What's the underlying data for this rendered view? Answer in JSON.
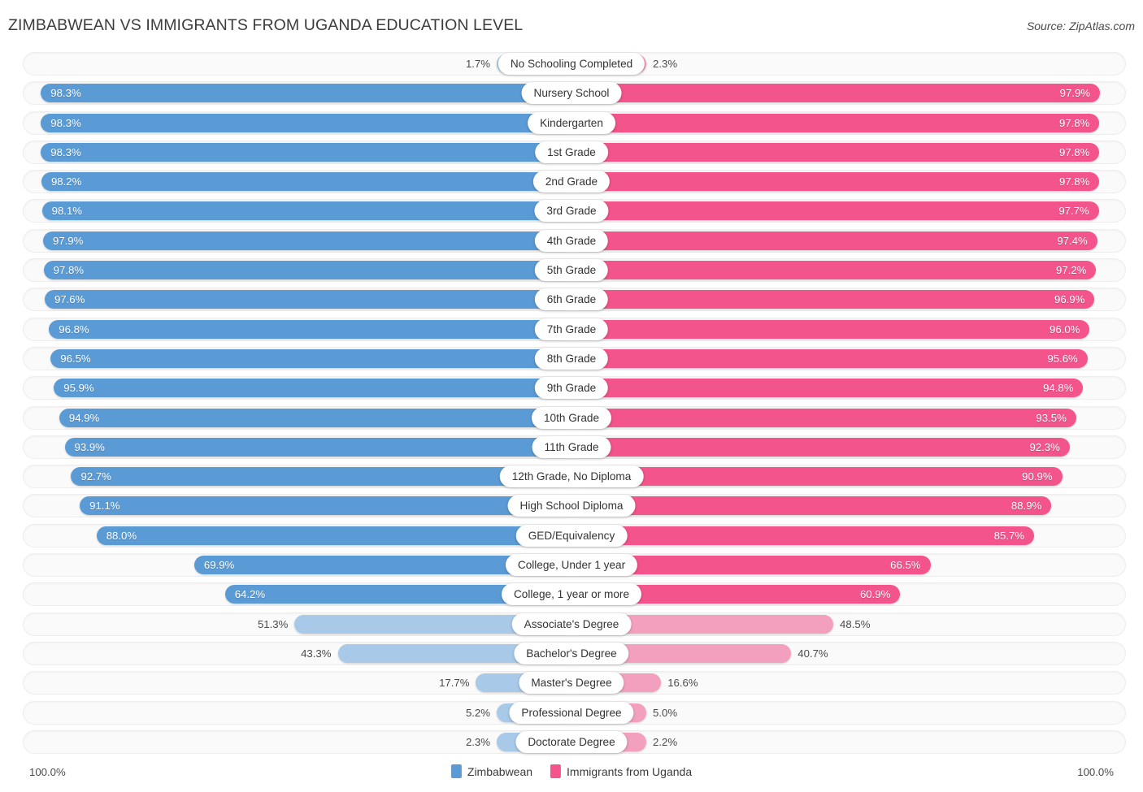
{
  "header": {
    "title": "ZIMBABWEAN VS IMMIGRANTS FROM UGANDA EDUCATION LEVEL",
    "source": "Source: ZipAtlas.com"
  },
  "legend": {
    "items": [
      {
        "label": "Zimbabwean",
        "color": "#5B9BD5"
      },
      {
        "label": "Immigrants from Uganda",
        "color": "#F2548B"
      }
    ]
  },
  "axis": {
    "left": "100.0%",
    "right": "100.0%"
  },
  "colors": {
    "blue_strong": "#5B9BD5",
    "blue_light": "#A8C9E8",
    "pink_strong": "#F2548B",
    "pink_light": "#F3A0BE",
    "track": "#fafafa"
  },
  "chart_data": {
    "type": "bar",
    "title": "ZIMBABWEAN VS IMMIGRANTS FROM UGANDA EDUCATION LEVEL",
    "orientation": "horizontal-diverging",
    "xlabel": "",
    "ylabel": "",
    "xlim": [
      0,
      100
    ],
    "grid": false,
    "legend_position": "bottom-center",
    "categories": [
      "No Schooling Completed",
      "Nursery School",
      "Kindergarten",
      "1st Grade",
      "2nd Grade",
      "3rd Grade",
      "4th Grade",
      "5th Grade",
      "6th Grade",
      "7th Grade",
      "8th Grade",
      "9th Grade",
      "10th Grade",
      "11th Grade",
      "12th Grade, No Diploma",
      "High School Diploma",
      "GED/Equivalency",
      "College, Under 1 year",
      "College, 1 year or more",
      "Associate's Degree",
      "Bachelor's Degree",
      "Master's Degree",
      "Professional Degree",
      "Doctorate Degree"
    ],
    "series": [
      {
        "name": "Zimbabwean",
        "color": "#5B9BD5",
        "values": [
          1.7,
          98.3,
          98.3,
          98.3,
          98.2,
          98.1,
          97.9,
          97.8,
          97.6,
          96.8,
          96.5,
          95.9,
          94.9,
          93.9,
          92.7,
          91.1,
          88.0,
          69.9,
          64.2,
          51.3,
          43.3,
          17.7,
          5.2,
          2.3
        ]
      },
      {
        "name": "Immigrants from Uganda",
        "color": "#F2548B",
        "values": [
          2.3,
          97.9,
          97.8,
          97.8,
          97.8,
          97.7,
          97.4,
          97.2,
          96.9,
          96.0,
          95.6,
          94.8,
          93.5,
          92.3,
          90.9,
          88.9,
          85.7,
          66.5,
          60.9,
          48.5,
          40.7,
          16.6,
          5.0,
          2.2
        ]
      }
    ]
  },
  "rows": [
    {
      "label": "No Schooling Completed",
      "left": "1.7%",
      "right": "2.3%",
      "lv": 1.7,
      "rv": 2.3,
      "tone": "light"
    },
    {
      "label": "Nursery School",
      "left": "98.3%",
      "right": "97.9%",
      "lv": 98.3,
      "rv": 97.9,
      "tone": "strong"
    },
    {
      "label": "Kindergarten",
      "left": "98.3%",
      "right": "97.8%",
      "lv": 98.3,
      "rv": 97.8,
      "tone": "strong"
    },
    {
      "label": "1st Grade",
      "left": "98.3%",
      "right": "97.8%",
      "lv": 98.3,
      "rv": 97.8,
      "tone": "strong"
    },
    {
      "label": "2nd Grade",
      "left": "98.2%",
      "right": "97.8%",
      "lv": 98.2,
      "rv": 97.8,
      "tone": "strong"
    },
    {
      "label": "3rd Grade",
      "left": "98.1%",
      "right": "97.7%",
      "lv": 98.1,
      "rv": 97.7,
      "tone": "strong"
    },
    {
      "label": "4th Grade",
      "left": "97.9%",
      "right": "97.4%",
      "lv": 97.9,
      "rv": 97.4,
      "tone": "strong"
    },
    {
      "label": "5th Grade",
      "left": "97.8%",
      "right": "97.2%",
      "lv": 97.8,
      "rv": 97.2,
      "tone": "strong"
    },
    {
      "label": "6th Grade",
      "left": "97.6%",
      "right": "96.9%",
      "lv": 97.6,
      "rv": 96.9,
      "tone": "strong"
    },
    {
      "label": "7th Grade",
      "left": "96.8%",
      "right": "96.0%",
      "lv": 96.8,
      "rv": 96.0,
      "tone": "strong"
    },
    {
      "label": "8th Grade",
      "left": "96.5%",
      "right": "95.6%",
      "lv": 96.5,
      "rv": 95.6,
      "tone": "strong"
    },
    {
      "label": "9th Grade",
      "left": "95.9%",
      "right": "94.8%",
      "lv": 95.9,
      "rv": 94.8,
      "tone": "strong"
    },
    {
      "label": "10th Grade",
      "left": "94.9%",
      "right": "93.5%",
      "lv": 94.9,
      "rv": 93.5,
      "tone": "strong"
    },
    {
      "label": "11th Grade",
      "left": "93.9%",
      "right": "92.3%",
      "lv": 93.9,
      "rv": 92.3,
      "tone": "strong"
    },
    {
      "label": "12th Grade, No Diploma",
      "left": "92.7%",
      "right": "90.9%",
      "lv": 92.7,
      "rv": 90.9,
      "tone": "strong"
    },
    {
      "label": "High School Diploma",
      "left": "91.1%",
      "right": "88.9%",
      "lv": 91.1,
      "rv": 88.9,
      "tone": "strong"
    },
    {
      "label": "GED/Equivalency",
      "left": "88.0%",
      "right": "85.7%",
      "lv": 88.0,
      "rv": 85.7,
      "tone": "strong"
    },
    {
      "label": "College, Under 1 year",
      "left": "69.9%",
      "right": "66.5%",
      "lv": 69.9,
      "rv": 66.5,
      "tone": "strong"
    },
    {
      "label": "College, 1 year or more",
      "left": "64.2%",
      "right": "60.9%",
      "lv": 64.2,
      "rv": 60.9,
      "tone": "strong"
    },
    {
      "label": "Associate's Degree",
      "left": "51.3%",
      "right": "48.5%",
      "lv": 51.3,
      "rv": 48.5,
      "tone": "light"
    },
    {
      "label": "Bachelor's Degree",
      "left": "43.3%",
      "right": "40.7%",
      "lv": 43.3,
      "rv": 40.7,
      "tone": "light"
    },
    {
      "label": "Master's Degree",
      "left": "17.7%",
      "right": "16.6%",
      "lv": 17.7,
      "rv": 16.6,
      "tone": "light"
    },
    {
      "label": "Professional Degree",
      "left": "5.2%",
      "right": "5.0%",
      "lv": 5.2,
      "rv": 5.0,
      "tone": "light"
    },
    {
      "label": "Doctorate Degree",
      "left": "2.3%",
      "right": "2.2%",
      "lv": 2.3,
      "rv": 2.2,
      "tone": "light"
    }
  ]
}
